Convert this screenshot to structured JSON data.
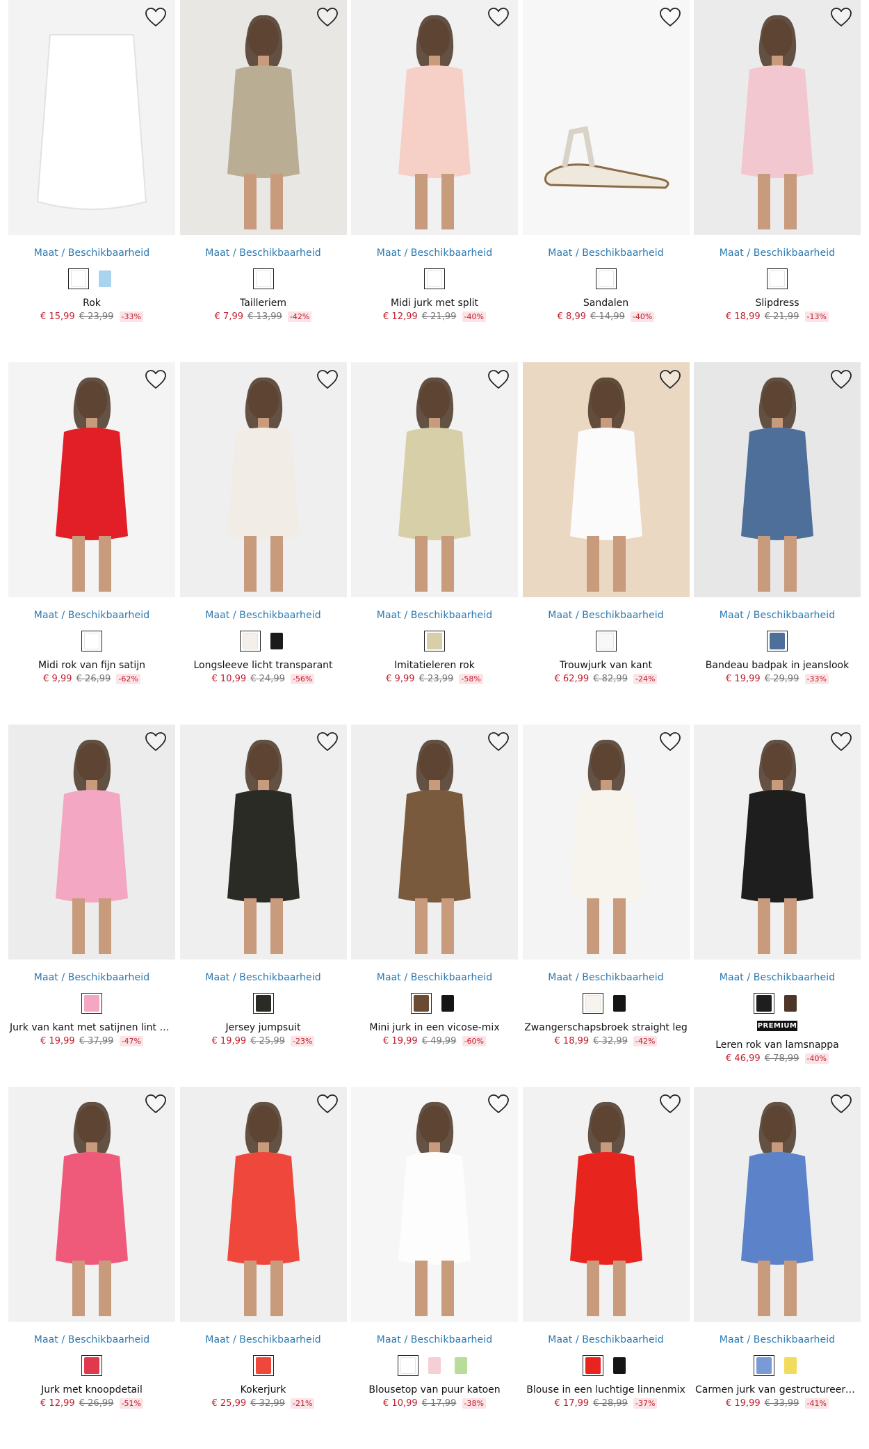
{
  "availability_label": "Maat / Beschikbaarheid",
  "premium_label": "PREMIUM",
  "colors": {
    "link": "#2a78b0",
    "sale": "#c0202e",
    "sale_bg": "#fce3e6"
  },
  "products": [
    {
      "title": "Rok",
      "price": "€ 15,99",
      "old": "€ 23,99",
      "disc": "-33%",
      "bg": "#f3f3f3",
      "fig": "#ffffff",
      "swatches": [
        "#ffffff",
        "#a8d4ef"
      ],
      "sel": 0,
      "kind": "skirt"
    },
    {
      "title": "Tailleriem",
      "price": "€ 7,99",
      "old": "€ 13,99",
      "disc": "-42%",
      "bg": "#e9e7e4",
      "fig": "#b9ad93",
      "swatches": [
        "#ffffff"
      ],
      "sel": 0,
      "kind": "model"
    },
    {
      "title": "Midi jurk met split",
      "price": "€ 12,99",
      "old": "€ 21,99",
      "disc": "-40%",
      "bg": "#f1f1f1",
      "fig": "#f6cfc6",
      "swatches": [
        "#ffffff"
      ],
      "sel": 0,
      "kind": "model"
    },
    {
      "title": "Sandalen",
      "price": "€ 8,99",
      "old": "€ 14,99",
      "disc": "-40%",
      "bg": "#f7f7f7",
      "fig": "#efe8dd",
      "swatches": [
        "#ffffff"
      ],
      "sel": 0,
      "kind": "shoe"
    },
    {
      "title": "Slipdress",
      "price": "€ 18,99",
      "old": "€ 21,99",
      "disc": "-13%",
      "bg": "#ebebeb",
      "fig": "#f2c7cf",
      "swatches": [
        "#ffffff"
      ],
      "sel": 0,
      "kind": "model"
    },
    {
      "title": "Midi rok van fijn satijn",
      "price": "€ 9,99",
      "old": "€ 26,99",
      "disc": "-62%",
      "bg": "#f4f4f4",
      "fig": "#e21f26",
      "swatches": [
        "#ffffff"
      ],
      "sel": 0,
      "kind": "model"
    },
    {
      "title": "Longsleeve licht transparant",
      "price": "€ 10,99",
      "old": "€ 24,99",
      "disc": "-56%",
      "bg": "#efefef",
      "fig": "#f2ece6",
      "swatches": [
        "#f4efe9",
        "#1b1b1b"
      ],
      "sel": 0,
      "kind": "model"
    },
    {
      "title": "Imitatieleren rok",
      "price": "€ 9,99",
      "old": "€ 23,99",
      "disc": "-58%",
      "bg": "#f2f2f2",
      "fig": "#d6cfa8",
      "swatches": [
        "#d6cfa8"
      ],
      "sel": 0,
      "kind": "model"
    },
    {
      "title": "Trouwjurk van kant",
      "price": "€ 62,99",
      "old": "€ 82,99",
      "disc": "-24%",
      "bg": "#ead8c2",
      "fig": "#fbfbfb",
      "swatches": [
        "#f8f8f8"
      ],
      "sel": 0,
      "kind": "model"
    },
    {
      "title": "Bandeau badpak in jeanslook",
      "price": "€ 19,99",
      "old": "€ 29,99",
      "disc": "-33%",
      "bg": "#e7e7e7",
      "fig": "#4f6f9b",
      "swatches": [
        "#4f6f9b"
      ],
      "sel": 0,
      "kind": "model"
    },
    {
      "title": "Jurk van kant met satijnen lint en volant",
      "price": "€ 19,99",
      "old": "€ 37,99",
      "disc": "-47%",
      "bg": "#ececec",
      "fig": "#f3a7c2",
      "swatches": [
        "#f3a7c2"
      ],
      "sel": 0,
      "kind": "model"
    },
    {
      "title": "Jersey jumpsuit",
      "price": "€ 19,99",
      "old": "€ 25,99",
      "disc": "-23%",
      "bg": "#efefef",
      "fig": "#2b2b26",
      "swatches": [
        "#2b2b26"
      ],
      "sel": 0,
      "kind": "model"
    },
    {
      "title": "Mini jurk in een vicose-mix",
      "price": "€ 19,99",
      "old": "€ 49,99",
      "disc": "-60%",
      "bg": "#efefef",
      "fig": "#7a5a3c",
      "swatches": [
        "#6b4c33",
        "#151515"
      ],
      "sel": 0,
      "kind": "model"
    },
    {
      "title": "Zwangerschapsbroek straight leg",
      "price": "€ 18,99",
      "old": "€ 32,99",
      "disc": "-42%",
      "bg": "#f4f4f4",
      "fig": "#f7f4ee",
      "swatches": [
        "#f7f4ee",
        "#151515"
      ],
      "sel": 0,
      "kind": "model"
    },
    {
      "title": "Leren rok van lamsnappa",
      "price": "€ 46,99",
      "old": "€ 78,99",
      "disc": "-40%",
      "bg": "#f0f0f0",
      "fig": "#1e1e1e",
      "swatches": [
        "#1e1e1e",
        "#4b3628"
      ],
      "sel": 0,
      "kind": "model",
      "premium": true
    },
    {
      "title": "Jurk met knoopdetail",
      "price": "€ 12,99",
      "old": "€ 26,99",
      "disc": "-51%",
      "bg": "#f1f1f1",
      "fig": "#ef5a7b",
      "swatches": [
        "#e0394e"
      ],
      "sel": 0,
      "kind": "model"
    },
    {
      "title": "Kokerjurk",
      "price": "€ 25,99",
      "old": "€ 32,99",
      "disc": "-21%",
      "bg": "#efefef",
      "fig": "#f0473c",
      "swatches": [
        "#f0473c"
      ],
      "sel": 0,
      "kind": "model"
    },
    {
      "title": "Blousetop van puur katoen",
      "price": "€ 10,99",
      "old": "€ 17,99",
      "disc": "-38%",
      "bg": "#f6f6f6",
      "fig": "#fdfdfd",
      "swatches": [
        "#ffffff",
        "#f6cfd6",
        "#b9dc9a"
      ],
      "sel": 0,
      "kind": "model"
    },
    {
      "title": "Blouse in een luchtige linnenmix",
      "price": "€ 17,99",
      "old": "€ 28,99",
      "disc": "-37%",
      "bg": "#f2f2f2",
      "fig": "#e8241f",
      "swatches": [
        "#e8241f",
        "#151515"
      ],
      "sel": 0,
      "kind": "model"
    },
    {
      "title": "Carmen jurk van gestructureerde viscose",
      "price": "€ 19,99",
      "old": "€ 33,99",
      "disc": "-41%",
      "bg": "#eeeeee",
      "fig": "#5c83c9",
      "swatches": [
        "#7a9ad6",
        "#f2dc5c"
      ],
      "sel": 0,
      "kind": "model"
    }
  ]
}
